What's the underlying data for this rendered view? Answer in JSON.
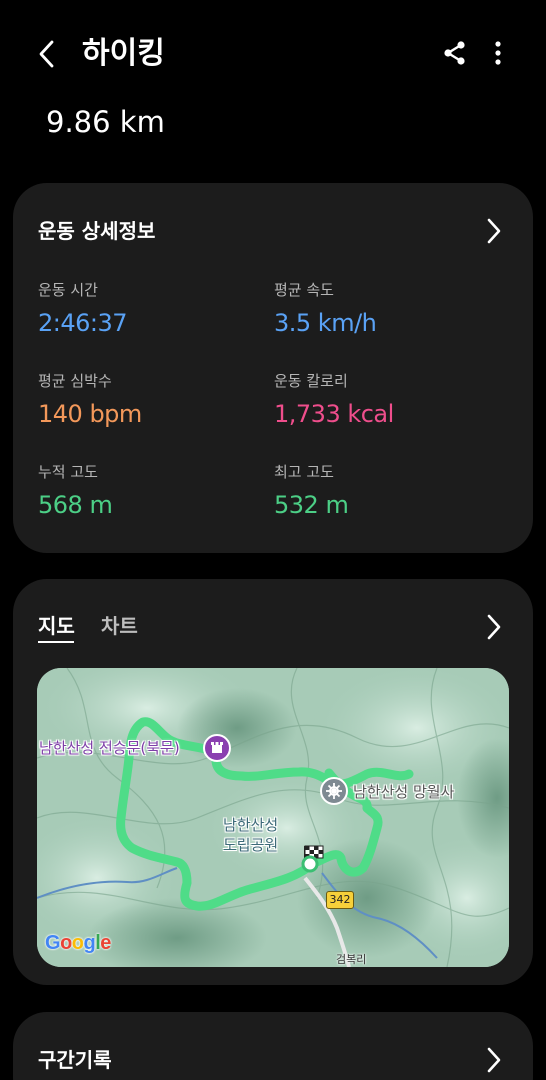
{
  "header": {
    "title": "하이킹",
    "back_icon": "chevron-left-icon",
    "share_icon": "share-icon",
    "more_icon": "more-vertical-icon"
  },
  "summary": {
    "distance": "9.86 km"
  },
  "details": {
    "title": "운동 상세정보",
    "stats": [
      {
        "label": "운동 시간",
        "value": "2:46:37",
        "color": "#5aa2f5"
      },
      {
        "label": "평균 속도",
        "value": "3.5 km/h",
        "color": "#5aa2f5"
      },
      {
        "label": "평균 심박수",
        "value": "140 bpm",
        "color": "#f3985a"
      },
      {
        "label": "운동 칼로리",
        "value": "1,733 kcal",
        "color": "#ef4e8c"
      },
      {
        "label": "누적 고도",
        "value": "568 m",
        "color": "#4ccf86"
      },
      {
        "label": "최고 고도",
        "value": "532 m",
        "color": "#4ccf86"
      }
    ]
  },
  "map_card": {
    "tabs": [
      {
        "label": "지도",
        "active": true
      },
      {
        "label": "차트",
        "active": false
      }
    ],
    "map": {
      "route_color": "#4fdc88",
      "labels": {
        "north_gate": "남한산성 전승문(북문)",
        "temple": "남한산성 망월사",
        "park_line1": "남한산성",
        "park_line2": "도립공원",
        "road": "342",
        "village": "검복리",
        "attribution": "Google"
      }
    }
  },
  "laps": {
    "title": "구간기록"
  }
}
